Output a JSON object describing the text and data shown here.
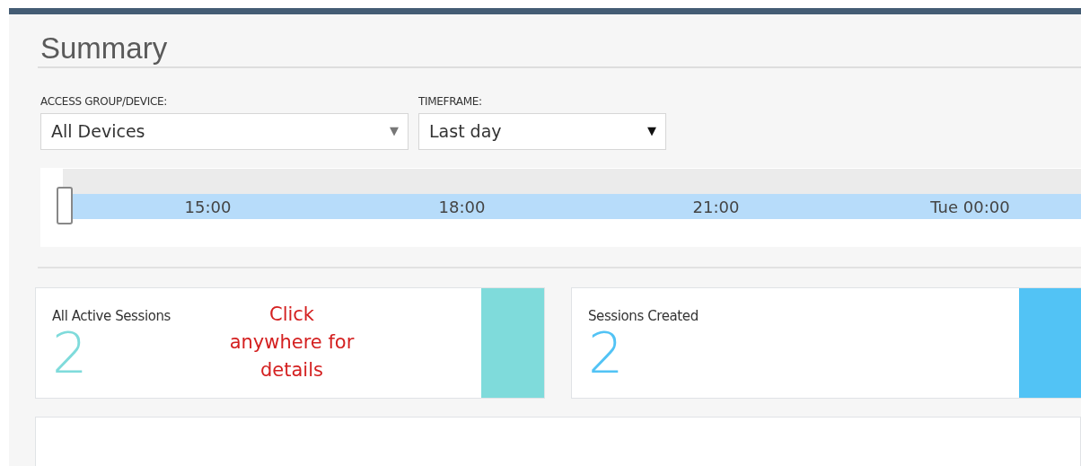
{
  "title": "Summary",
  "filters": [
    {
      "label": "ACCESS GROUP/DEVICE:",
      "value": "All Devices",
      "caret": "▼",
      "kind": "wide"
    },
    {
      "label": "TIMEFRAME:",
      "value": "Last day",
      "caret": "▼",
      "kind": "narrow"
    }
  ],
  "timeline": {
    "ticks": [
      "15:00",
      "18:00",
      "21:00",
      "Tue 00:00"
    ],
    "handle": {
      "level": 0
    }
  },
  "cards": [
    {
      "label": "All Active Sessions",
      "value": "2",
      "color": "#7fdbdb"
    },
    {
      "label": "Sessions Created",
      "value": "2",
      "color": "#52c3f5"
    }
  ],
  "callout": {
    "lines": [
      "Click",
      "anywhere for",
      "details"
    ]
  }
}
